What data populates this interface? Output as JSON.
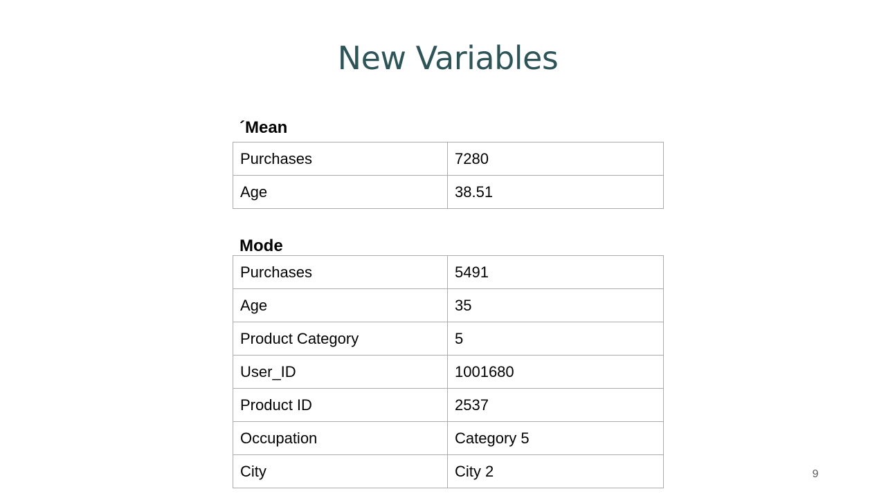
{
  "slide": {
    "title": "New Variables",
    "page_number": "9"
  },
  "mean": {
    "label": "´Mean",
    "rows": [
      {
        "key": "Purchases",
        "value": "7280"
      },
      {
        "key": "Age",
        "value": "38.51"
      }
    ]
  },
  "mode": {
    "label": "Mode",
    "rows": [
      {
        "key": "Purchases",
        "value": "5491"
      },
      {
        "key": "Age",
        "value": "35"
      },
      {
        "key": "Product Category",
        "value": "5"
      },
      {
        "key": "User_ID",
        "value": "1001680"
      },
      {
        "key": "Product ID",
        "value": "2537"
      },
      {
        "key": "Occupation",
        "value": "Category 5"
      },
      {
        "key": "City",
        "value": "City 2"
      }
    ]
  },
  "colors": {
    "title": "#2e5457",
    "border": "#aaaaaa",
    "page_number": "#595959"
  }
}
